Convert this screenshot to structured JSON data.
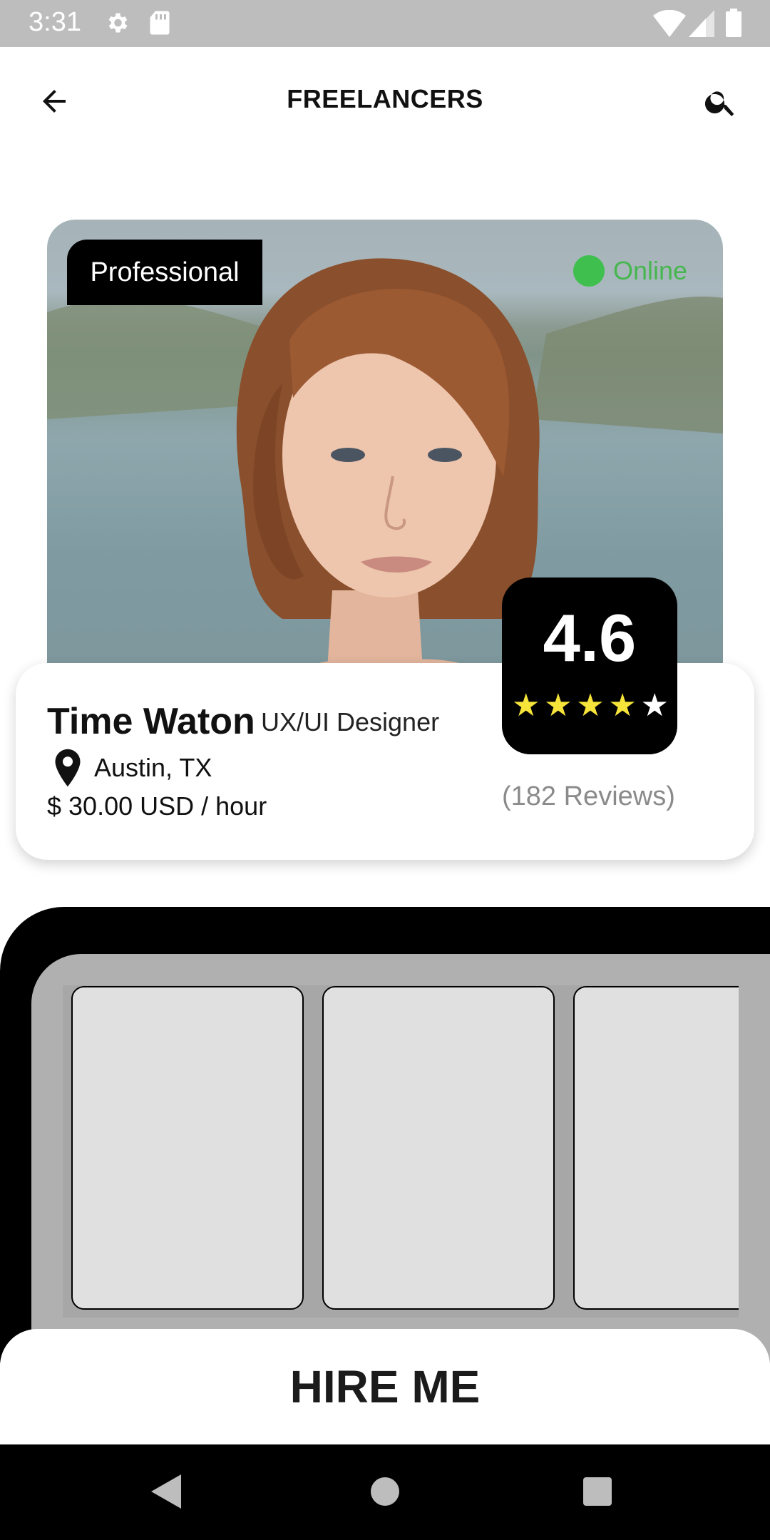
{
  "status_bar": {
    "time": "3:31"
  },
  "header": {
    "title": "FREELANCERS"
  },
  "profile": {
    "badge": "Professional",
    "online_label": "Online",
    "name": "Time Waton",
    "role": "UX/UI Designer",
    "location": "Austin, TX",
    "rate": "$ 30.00 USD / hour",
    "rating": "4.6",
    "stars_filled": 4,
    "stars_total": 5,
    "reviews": "(182 Reviews)"
  },
  "actions": {
    "hire_label": "HIRE ME"
  },
  "colors": {
    "online": "#3fbf4d",
    "star_filled": "#f6e43a",
    "star_empty": "#ffffff"
  }
}
